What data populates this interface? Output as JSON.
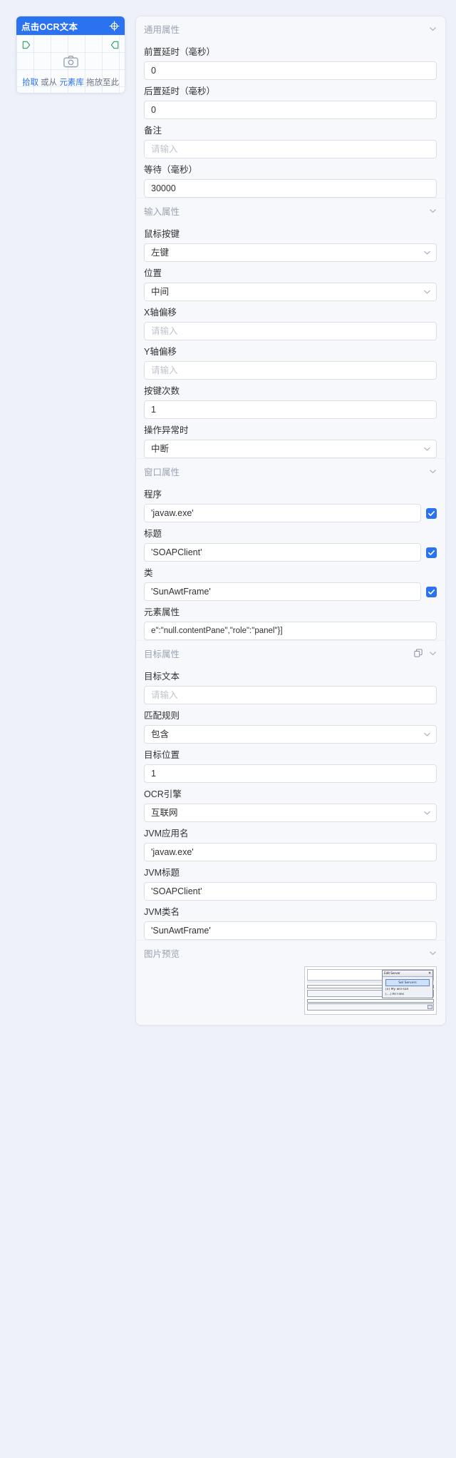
{
  "capture_card": {
    "title": "点击OCR文本",
    "target_icon": "crosshair-icon",
    "camera_icon": "camera-icon",
    "hint_pick": "拾取",
    "hint_mid": " 或从 ",
    "hint_lib": "元素库",
    "hint_end": " 拖放至此"
  },
  "panel": {
    "groups": [
      {
        "title": "通用属性",
        "fields": [
          {
            "label": "前置延时（毫秒）",
            "type": "input",
            "value": "0",
            "placeholder": ""
          },
          {
            "label": "后置延时（毫秒）",
            "type": "input",
            "value": "0",
            "placeholder": ""
          },
          {
            "label": "备注",
            "type": "input",
            "value": "",
            "placeholder": "请输入"
          },
          {
            "label": "等待（毫秒）",
            "type": "input",
            "value": "30000",
            "placeholder": ""
          }
        ]
      },
      {
        "title": "输入属性",
        "fields": [
          {
            "label": "鼠标按键",
            "type": "select",
            "value": "左键"
          },
          {
            "label": "位置",
            "type": "select",
            "value": "中间"
          },
          {
            "label": "X轴偏移",
            "type": "input",
            "value": "",
            "placeholder": "请输入"
          },
          {
            "label": "Y轴偏移",
            "type": "input",
            "value": "",
            "placeholder": "请输入"
          },
          {
            "label": "按键次数",
            "type": "input",
            "value": "1",
            "placeholder": ""
          },
          {
            "label": "操作异常时",
            "type": "select",
            "value": "中断"
          }
        ]
      },
      {
        "title": "窗口属性",
        "fields": [
          {
            "label": "程序",
            "type": "input",
            "value": "'javaw.exe'",
            "placeholder": "",
            "checkbox": true
          },
          {
            "label": "标题",
            "type": "input",
            "value": "'SOAPClient'",
            "placeholder": "",
            "checkbox": true
          },
          {
            "label": "类",
            "type": "input",
            "value": "'SunAwtFrame'",
            "placeholder": "",
            "checkbox": true
          },
          {
            "label": "元素属性",
            "type": "input",
            "value": "e\":\"null.contentPane\",\"role\":\"panel\"}]",
            "placeholder": "",
            "mono": true
          }
        ]
      },
      {
        "title": "目标属性",
        "has_copy_icon": true,
        "fields": [
          {
            "label": "目标文本",
            "type": "input",
            "value": "",
            "placeholder": "请输入"
          },
          {
            "label": "匹配规则",
            "type": "select",
            "value": "包含"
          },
          {
            "label": "目标位置",
            "type": "input",
            "value": "1",
            "placeholder": ""
          },
          {
            "label": "OCR引擎",
            "type": "select",
            "value": "互联网"
          },
          {
            "label": "JVM应用名",
            "type": "input",
            "value": "'javaw.exe'",
            "placeholder": ""
          },
          {
            "label": "JVM标题",
            "type": "input",
            "value": "'SOAPClient'",
            "placeholder": ""
          },
          {
            "label": "JVM类名",
            "type": "input",
            "value": "'SunAwtFrame'",
            "placeholder": ""
          }
        ]
      },
      {
        "title": "图片预览",
        "fields": [],
        "preview": {
          "dialog_title": "Edit Server",
          "dialog_close": "✕",
          "dialog_button": "Sel Servers",
          "dialog_line1": "[x] My wsl-san",
          "dialog_line2": "[...] All Files"
        }
      }
    ]
  },
  "colors": {
    "accent": "#2b72f0",
    "panel_bg": "#f7f8fb",
    "page_bg": "#eef1f8",
    "marker_green": "#2f9e5e",
    "label": "#303133",
    "muted": "#9aa3b2",
    "placeholder": "#c0c4cc"
  }
}
